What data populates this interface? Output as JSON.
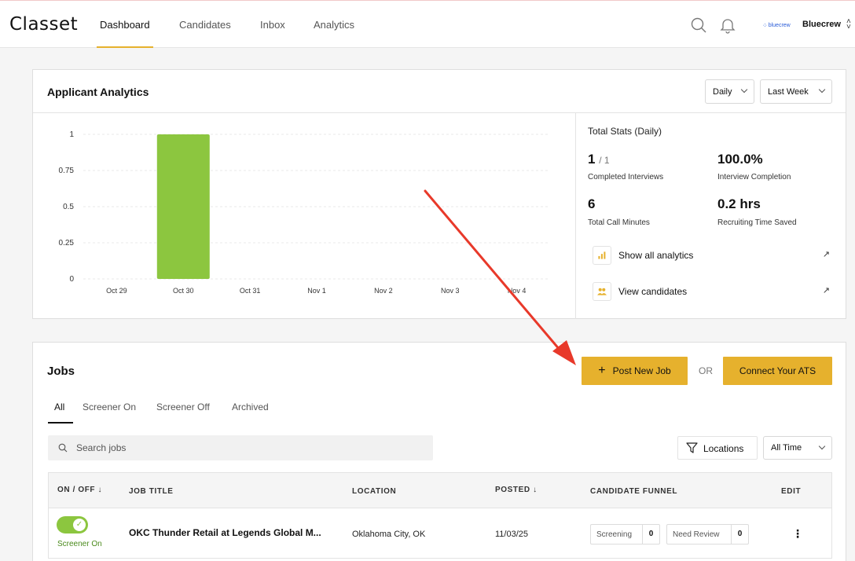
{
  "brand": {
    "logo": "Classet",
    "org_small": "bluecrew",
    "org_name": "Bluecrew"
  },
  "nav": {
    "items": [
      "Dashboard",
      "Candidates",
      "Inbox",
      "Analytics"
    ]
  },
  "analytics": {
    "title": "Applicant Analytics",
    "granularity": "Daily",
    "range": "Last Week",
    "stats_title": "Total Stats (Daily)",
    "completed_value": "1",
    "completed_of": "/ 1",
    "completed_label": "Completed Interviews",
    "completion_value": "100.0%",
    "completion_label": "Interview Completion",
    "minutes_value": "6",
    "minutes_label": "Total Call Minutes",
    "saved_value": "0.2 hrs",
    "saved_label": "Recruiting Time Saved",
    "link_analytics": "Show all analytics",
    "link_candidates": "View candidates",
    "accent_color": "#8cc63f"
  },
  "chart_data": {
    "type": "bar",
    "categories": [
      "Oct 29",
      "Oct 30",
      "Oct 31",
      "Nov 1",
      "Nov 2",
      "Nov 3",
      "Nov 4"
    ],
    "values": [
      0,
      1,
      0,
      0,
      0,
      0,
      0
    ],
    "yticks": [
      "0",
      "0.25",
      "0.5",
      "0.75",
      "1"
    ],
    "ylim": [
      0,
      1
    ],
    "grid": true,
    "color": "#8cc63f"
  },
  "jobs": {
    "title": "Jobs",
    "post_button": "Post New Job",
    "or_text": "OR",
    "ats_button": "Connect Your ATS",
    "tabs": [
      "All",
      "Screener On",
      "Screener Off",
      "Archived"
    ],
    "search_placeholder": "Search jobs",
    "locations_button": "Locations",
    "time_filter": "All Time",
    "columns": [
      "ON / OFF ↓",
      "JOB TITLE",
      "LOCATION",
      "POSTED ↓",
      "CANDIDATE FUNNEL",
      "EDIT"
    ],
    "rows": [
      {
        "status": "Screener On",
        "title": "OKC Thunder Retail at Legends Global M...",
        "location": "Oklahoma City, OK",
        "posted": "11/03/25",
        "screening_label": "Screening",
        "screening_count": "0",
        "review_label": "Need Review",
        "review_count": "0"
      }
    ]
  }
}
